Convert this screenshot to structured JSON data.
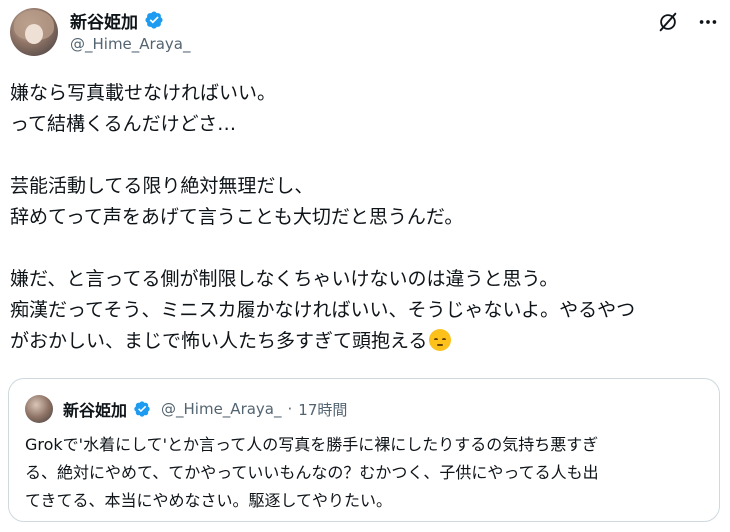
{
  "author": {
    "display_name": "新谷姫加",
    "handle": "@_Hime_Araya_"
  },
  "icons": {
    "verified": "verified-badge-icon",
    "grok": "grok-icon",
    "more": "more-options-icon",
    "emoji": "pensive-face-emoji"
  },
  "tweet": {
    "lines": [
      "嫌なら写真載せなければいい。",
      "って結構くるんだけどさ…",
      "",
      "芸能活動してる限り絶対無理だし、",
      "辞めてって声をあげて言うことも大切だと思うんだ。",
      "",
      "嫌だ、と言ってる側が制限しなくちゃいけないのは違うと思う。",
      "痴漢だってそう、ミニスカ履かなければいい、そうじゃないよ。やるやつ",
      "がおかしい、まじで怖い人たち多すぎて頭抱える"
    ]
  },
  "quote": {
    "display_name": "新谷姫加",
    "handle": "@_Hime_Araya_",
    "separator": "·",
    "time": "17時間",
    "lines": [
      "Grokで'水着にして'とか言って人の写真を勝手に裸にしたりするの気持ち悪すぎ",
      "る、絶対にやめて、てかやっていいもんなの？むかつく、子供にやってる人も出",
      "てきてる、本当にやめなさい。駆逐してやりたい。"
    ]
  },
  "colors": {
    "text": "#0f1419",
    "secondary": "#536471",
    "verified": "#1d9bf0",
    "border": "#cfd9de"
  }
}
